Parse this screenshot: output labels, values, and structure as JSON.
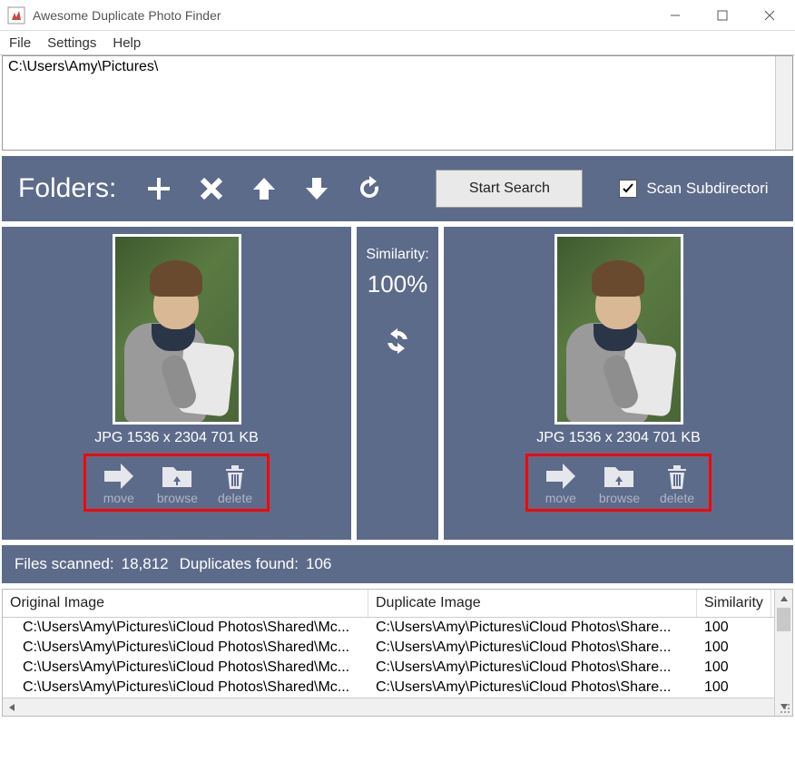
{
  "window": {
    "title": "Awesome Duplicate Photo Finder"
  },
  "menu": {
    "file": "File",
    "settings": "Settings",
    "help": "Help"
  },
  "pathbox": {
    "path": "C:\\Users\\Amy\\Pictures\\"
  },
  "toolbar": {
    "label": "Folders:",
    "start_search": "Start Search",
    "scan_sub": "Scan Subdirectori"
  },
  "similarity": {
    "label": "Similarity:",
    "value": "100%"
  },
  "preview": {
    "left": {
      "meta": "JPG  1536 x 2304  701 KB"
    },
    "right": {
      "meta": "JPG  1536 x 2304  701 KB"
    },
    "actions": {
      "move": "move",
      "browse": "browse",
      "delete": "delete"
    }
  },
  "status": {
    "scanned_label": "Files scanned:",
    "scanned_value": "18,812",
    "dup_label": "Duplicates found:",
    "dup_value": "106"
  },
  "table": {
    "headers": {
      "original": "Original Image",
      "duplicate": "Duplicate Image",
      "similarity": "Similarity"
    },
    "rows": [
      {
        "orig": "C:\\Users\\Amy\\Pictures\\iCloud Photos\\Shared\\Mc...",
        "dup": "C:\\Users\\Amy\\Pictures\\iCloud Photos\\Share...",
        "sim": "100"
      },
      {
        "orig": "C:\\Users\\Amy\\Pictures\\iCloud Photos\\Shared\\Mc...",
        "dup": "C:\\Users\\Amy\\Pictures\\iCloud Photos\\Share...",
        "sim": "100"
      },
      {
        "orig": "C:\\Users\\Amy\\Pictures\\iCloud Photos\\Shared\\Mc...",
        "dup": "C:\\Users\\Amy\\Pictures\\iCloud Photos\\Share...",
        "sim": "100"
      },
      {
        "orig": "C:\\Users\\Amy\\Pictures\\iCloud Photos\\Shared\\Mc...",
        "dup": "C:\\Users\\Amy\\Pictures\\iCloud Photos\\Share...",
        "sim": "100"
      }
    ]
  }
}
